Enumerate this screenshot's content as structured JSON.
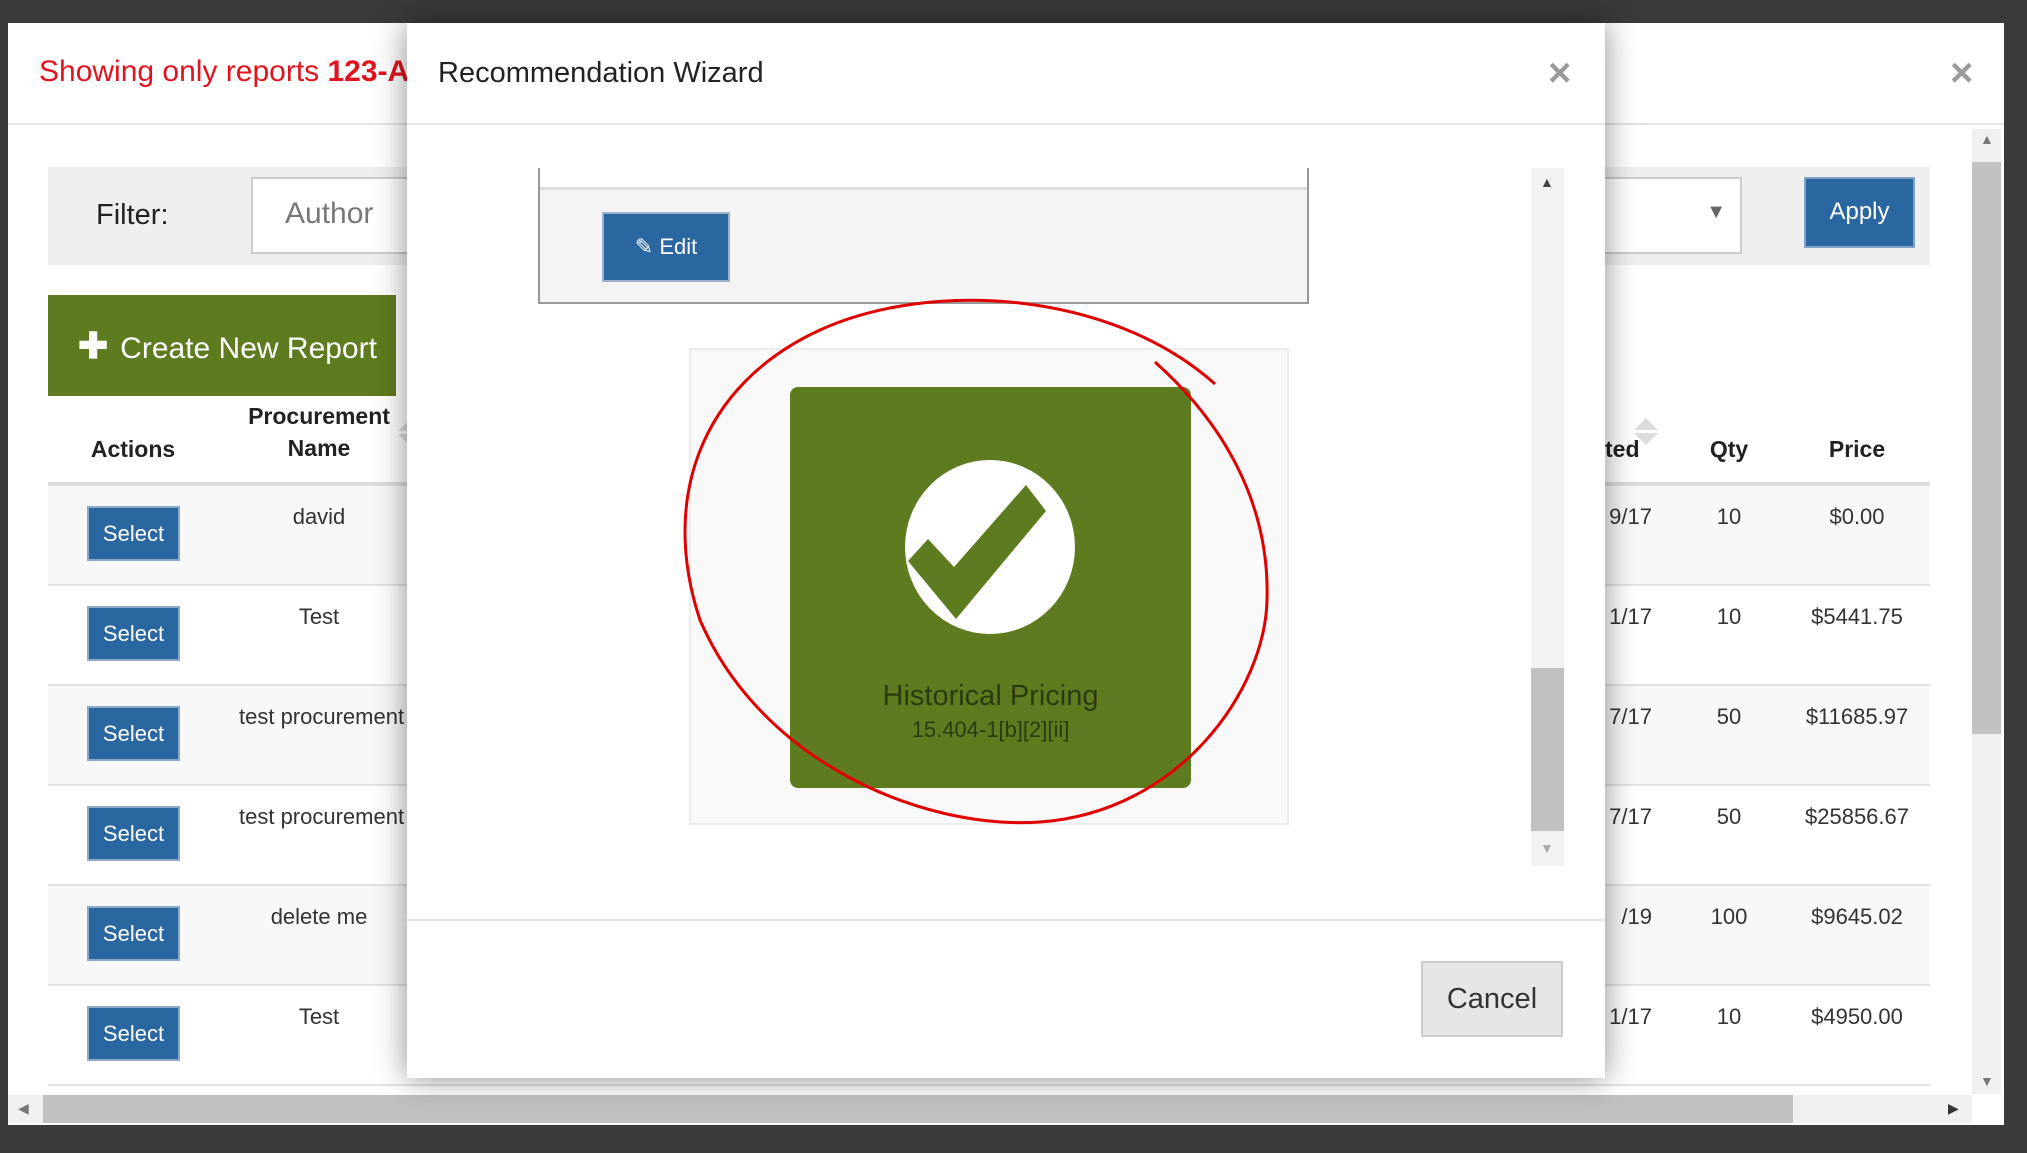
{
  "outer_modal": {
    "notice_prefix": "Showing only reports ",
    "notice_bold": "123-A",
    "close_label": "×",
    "filter": {
      "label": "Filter:",
      "author_placeholder": "Author",
      "apply_label": "Apply"
    },
    "create_button": "Create New Report",
    "table": {
      "headers": {
        "actions": "Actions",
        "name_line1": "Procurement",
        "name_line2": "Name",
        "date_fragment": "ted",
        "qty": "Qty",
        "price": "Price"
      },
      "select_label": "Select",
      "rows": [
        {
          "name": "david",
          "date": "9/17",
          "qty": "10",
          "price": "$0.00"
        },
        {
          "name": "Test",
          "date": "1/17",
          "qty": "10",
          "price": "$5441.75"
        },
        {
          "name": "test procurement",
          "date": "7/17",
          "qty": "50",
          "price": "$11685.97"
        },
        {
          "name": "test procurement",
          "date": "7/17",
          "qty": "50",
          "price": "$25856.67"
        },
        {
          "name": "delete me",
          "date": "/19",
          "qty": "100",
          "price": "$9645.02"
        },
        {
          "name": "Test",
          "date": "1/17",
          "qty": "10",
          "price": "$4950.00"
        }
      ]
    }
  },
  "wizard": {
    "title": "Recommendation Wizard",
    "close_label": "×",
    "edit_label": "Edit",
    "tile": {
      "title": "Historical Pricing",
      "subtitle": "15.404-1[b][2][ii]",
      "icon": "check-circle-icon"
    },
    "cancel_label": "Cancel"
  },
  "colors": {
    "brand_green": "#5e7b1f",
    "primary_blue": "#2a66a0",
    "notice_red": "#e0141e",
    "annotation_red": "#e00000"
  }
}
